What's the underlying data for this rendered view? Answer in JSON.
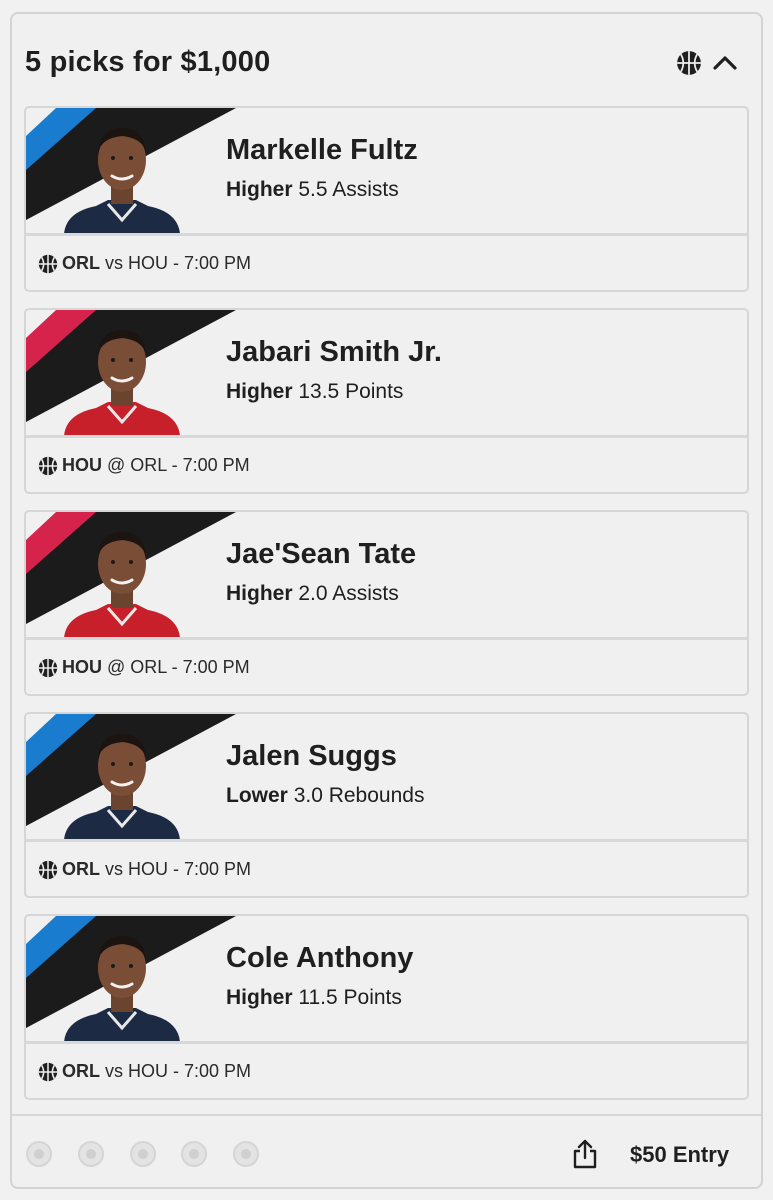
{
  "header": {
    "title": "5 picks for $1,000",
    "sport_icon": "basketball-icon",
    "collapse_icon": "chevron-up-icon"
  },
  "picks": [
    {
      "player": "Markelle Fultz",
      "direction": "Higher",
      "line": "5.5 Assists",
      "team": "ORL",
      "matchup": "vs HOU - 7:00 PM",
      "team_color": "#1a7ccf",
      "jersey_color": "#1c2a44"
    },
    {
      "player": "Jabari Smith Jr.",
      "direction": "Higher",
      "line": "13.5 Points",
      "team": "HOU",
      "matchup": "@ ORL - 7:00 PM",
      "team_color": "#d6234c",
      "jersey_color": "#c8202b"
    },
    {
      "player": "Jae'Sean Tate",
      "direction": "Higher",
      "line": "2.0 Assists",
      "team": "HOU",
      "matchup": "@ ORL - 7:00 PM",
      "team_color": "#d6234c",
      "jersey_color": "#c8202b"
    },
    {
      "player": "Jalen Suggs",
      "direction": "Lower",
      "line": "3.0 Rebounds",
      "team": "ORL",
      "matchup": "vs HOU - 7:00 PM",
      "team_color": "#1a7ccf",
      "jersey_color": "#1c2a44"
    },
    {
      "player": "Cole Anthony",
      "direction": "Higher",
      "line": "11.5 Points",
      "team": "ORL",
      "matchup": "vs HOU - 7:00 PM",
      "team_color": "#1a7ccf",
      "jersey_color": "#1c2a44"
    }
  ],
  "footer": {
    "dot_count": 5,
    "share_icon": "share-icon",
    "entry_label": "$50 Entry"
  }
}
